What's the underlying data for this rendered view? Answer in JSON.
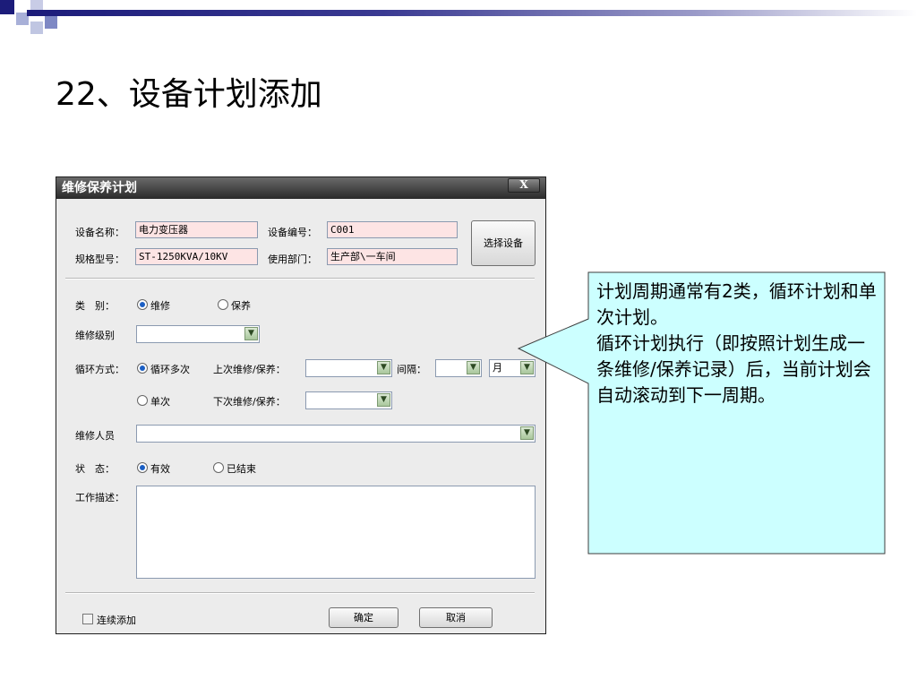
{
  "slide": {
    "title": "22、设备计划添加"
  },
  "dialog": {
    "title": "维修保养计划",
    "close_label": "X",
    "device_name_label": "设备名称：",
    "device_name_value": "电力变压器",
    "device_code_label": "设备编号：",
    "device_code_value": "C001",
    "model_label": "规格型号：",
    "model_value": "ST-1250KVA/10KV",
    "dept_label": "使用部门：",
    "dept_value": "生产部\\一车间",
    "select_device_button": "选择设备",
    "category_label": "类　别：",
    "category_options": [
      "维修",
      "保养"
    ],
    "category_selected": "维修",
    "repair_level_label": "维修级别",
    "repair_level_value": "",
    "cycle_label": "循环方式：",
    "cycle_options": [
      "循环多次",
      "单次"
    ],
    "cycle_selected": "循环多次",
    "last_label": "上次维修/保养：",
    "last_value": "",
    "interval_label": "间隔：",
    "interval_value": "",
    "interval_unit": "月",
    "next_label": "下次维修/保养：",
    "next_value": "",
    "staff_label": "维修人员",
    "staff_value": "",
    "status_label": "状　态：",
    "status_options": [
      "有效",
      "已结束"
    ],
    "status_selected": "有效",
    "desc_label": "工作描述：",
    "desc_value": "",
    "continuous_add_label": "连续添加",
    "ok_button": "确定",
    "cancel_button": "取消"
  },
  "callout": {
    "text": "计划周期通常有2类，循环计划和单次计划。\n循环计划执行（即按照计划生成一条维修/保养记录）后，当前计划会自动滚动到下一周期。"
  },
  "colors": {
    "accent": "#1c1c7a",
    "callout_fill": "#ccffff",
    "pink_field": "#fde4e4"
  }
}
